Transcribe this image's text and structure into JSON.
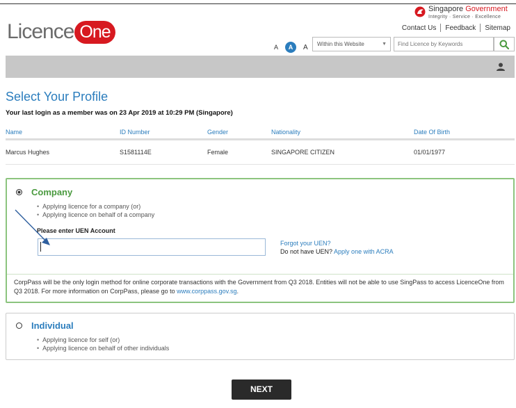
{
  "brand": {
    "logo_part1": "Licence",
    "logo_part2": "One",
    "gov_name_part1": "Singapore ",
    "gov_name_part2": "Government",
    "gov_tagline": "Integrity · Service · Excellence",
    "brand_red": "#d71920",
    "accent_blue": "#2b7dbd",
    "accent_green": "#4a9a3f"
  },
  "top_links": [
    "Contact Us",
    "Feedback",
    "Sitemap"
  ],
  "font_sizes": [
    "A",
    "A",
    "A"
  ],
  "search": {
    "scope_value": "Within this Website",
    "placeholder": "Find Licence by Keywords"
  },
  "page": {
    "title": "Select Your Profile",
    "last_login": "Your last login as a member was on 23 Apr 2019 at 10:29 PM (Singapore)"
  },
  "profile_table": {
    "headers": [
      "Name",
      "ID Number",
      "Gender",
      "Nationality",
      "Date Of Birth"
    ],
    "row": [
      "Marcus Hughes",
      "S1581114E",
      "Female",
      "SINGAPORE CITIZEN",
      "01/01/1977"
    ]
  },
  "company": {
    "title": "Company",
    "bullets": [
      "Applying licence for a company (or)",
      "Applying licence on behalf of a company"
    ],
    "uen_label": "Please enter UEN Account",
    "uen_value": "",
    "forgot_link": "Forgot your UEN?",
    "no_uen_text": "Do not have UEN? ",
    "apply_link": "Apply one with ACRA",
    "corppass_text": "CorpPass will be the only login method for online corporate transactions with the Government from Q3 2018. Entities will not be able to use SingPass to access LicenceOne from Q3 2018. For more information on CorpPass, please go to ",
    "corppass_link": "www.corppass.gov.sg",
    "corppass_end": "."
  },
  "individual": {
    "title": "Individual",
    "bullets": [
      "Applying licence for self (or)",
      "Applying licence on behalf of other individuals"
    ]
  },
  "actions": {
    "next_label": "NEXT"
  }
}
